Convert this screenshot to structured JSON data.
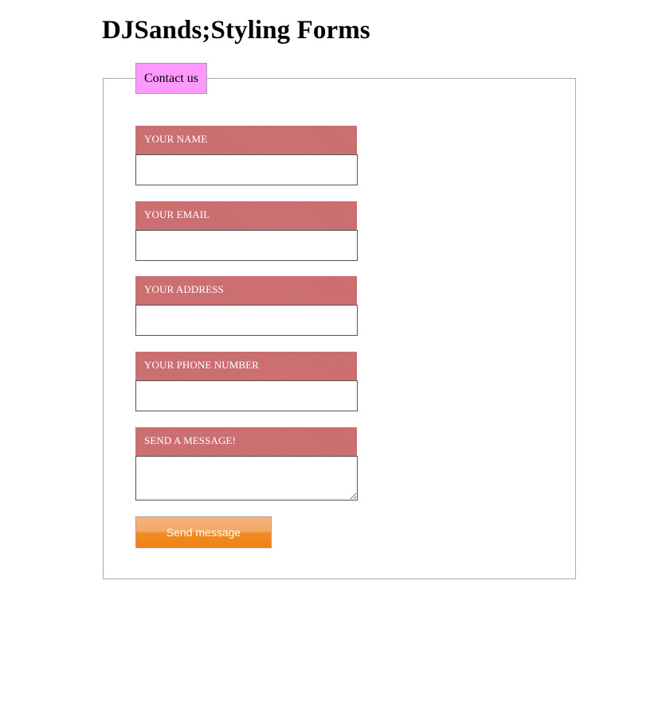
{
  "page": {
    "title": "DJSands;Styling Forms"
  },
  "form": {
    "legend": "Contact us",
    "fields": [
      {
        "label": "YOUR NAME",
        "value": ""
      },
      {
        "label": "YOUR EMAIL",
        "value": ""
      },
      {
        "label": "YOUR ADDRESS",
        "value": ""
      },
      {
        "label": "YOUR PHONE NUMBER",
        "value": ""
      },
      {
        "label": "SEND A MESSAGE!",
        "value": ""
      }
    ],
    "submit_label": "Send message"
  },
  "colors": {
    "label_background": "#cd6f70",
    "legend_background": "#ff99ff",
    "button_gradient_top": "#f6b27a",
    "button_gradient_bottom": "#ee8418"
  }
}
